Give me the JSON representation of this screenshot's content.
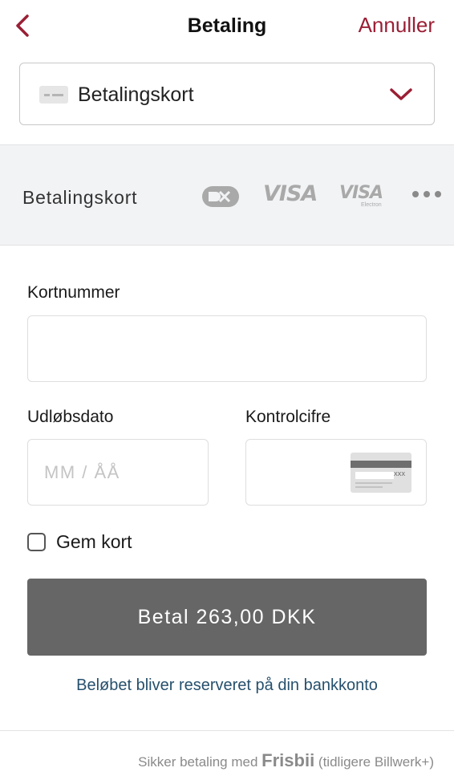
{
  "header": {
    "title": "Betaling",
    "cancel_label": "Annuller"
  },
  "payment_method": {
    "selected": "Betalingskort"
  },
  "brand_strip": {
    "label": "Betalingskort",
    "visa_text": "VISA",
    "visa_electron_text": "VISA",
    "visa_electron_sub": "Electron"
  },
  "form": {
    "card_number_label": "Kortnummer",
    "card_number_value": "",
    "expiry_label": "Udløbsdato",
    "expiry_placeholder": "MM / ÅÅ",
    "cvc_label": "Kontrolcifre",
    "cvc_icon_text": "XXX",
    "save_card_label": "Gem kort"
  },
  "pay_button": {
    "label": "Betal 263,00 DKK"
  },
  "reserve_note": "Beløbet bliver reserveret på din bankkonto",
  "footer": {
    "prefix": "Sikker betaling med",
    "brand": "Frisbii",
    "suffix": "(tidligere Billwerk+)"
  },
  "colors": {
    "accent": "#9a1f35",
    "pay_button": "#666666",
    "link": "#26506d",
    "strip_background": "#f2f3f5"
  }
}
